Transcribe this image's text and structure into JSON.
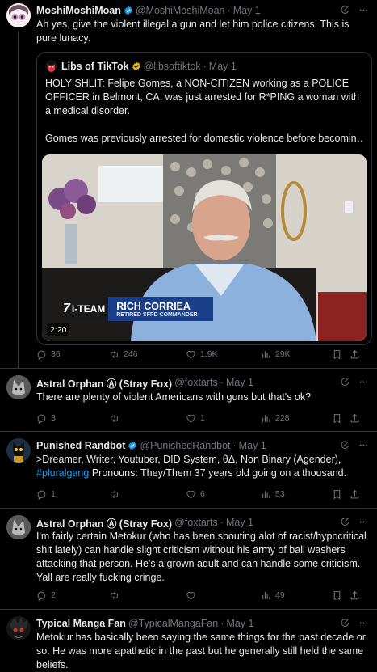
{
  "colors": {
    "background": "#000000",
    "text": "#e7e9ea",
    "muted": "#71767b",
    "link": "#1d9bf0",
    "divider": "#2f3336",
    "verified": "#1d9bf0",
    "gold": "#e2b719"
  },
  "tweets": [
    {
      "name": "MoshiMoshiMoan",
      "handle": "@MoshiMoshiMoan",
      "date": "May 1",
      "text": "Ah yes, give the violent illegal a gun and let him police citizens.  This is pure lunacy.",
      "quote": {
        "name": "Libs of TikTok",
        "handle": "@libsoftiktok",
        "date": "May 1",
        "text1": "HOLY SHLIT: Felipe Gomes, a NON-CITIZEN working as a POLICE OFFICER in Belmont, CA, was just arrested for R*PING a woman with a medical disorder.",
        "text2": "Gomes was previously arrested for domestic violence before becomin…",
        "video": {
          "lower_third_name": "RICH CORRIEA",
          "lower_third_title": "RETIRED SFPD COMMANDER",
          "station": "I-TEAM",
          "station_number": "7",
          "duration": "2:20"
        }
      },
      "replies": "36",
      "reposts": "246",
      "likes": "1.9K",
      "views": "29K"
    },
    {
      "name": "Astral Orphan ⒶⒶ (Stray Fox)",
      "handle": "@foxtarts",
      "date": "May 1",
      "text": "There are plenty of violent Americans with guns but that's ok?",
      "replies": "3",
      "reposts": "",
      "likes": "1",
      "views": "228"
    },
    {
      "name": "Punished Randbot",
      "handle": "@PunishedRandbot",
      "date": "May 1",
      "text_pre": ">Dreamer, Writer, Youtuber, DID System, θΔ, Non Binary (Agender),",
      "hashtag": "#pluralgang",
      "text_post": " Pronouns: They/Them 37 years old going on a thousand.",
      "replies": "1",
      "reposts": "",
      "likes": "6",
      "views": "53"
    },
    {
      "name": "Astral Orphan ⒶⒶ (Stray Fox)",
      "handle": "@foxtarts",
      "date": "May 1",
      "text": "I'm fairly certain Metokur (who has been spouting alot of racist/hypocritical shit lately) can handle slight criticism without his army of ball washers attacking that person. He's a grown adult and can handle some criticism. Yall are really fucking cringe.",
      "replies": "2",
      "reposts": "",
      "likes": "",
      "views": "49"
    },
    {
      "name": "Typical Manga Fan",
      "handle": "@TypicalMangaFan",
      "date": "May 1",
      "text": "Metokur has basically been saying the same things for the past decade or so. He was more apathetic in the past but he generally still held the same beliefs."
    }
  ],
  "display_names": [
    "Astral Orphan Ⓐ (Stray Fox)"
  ]
}
